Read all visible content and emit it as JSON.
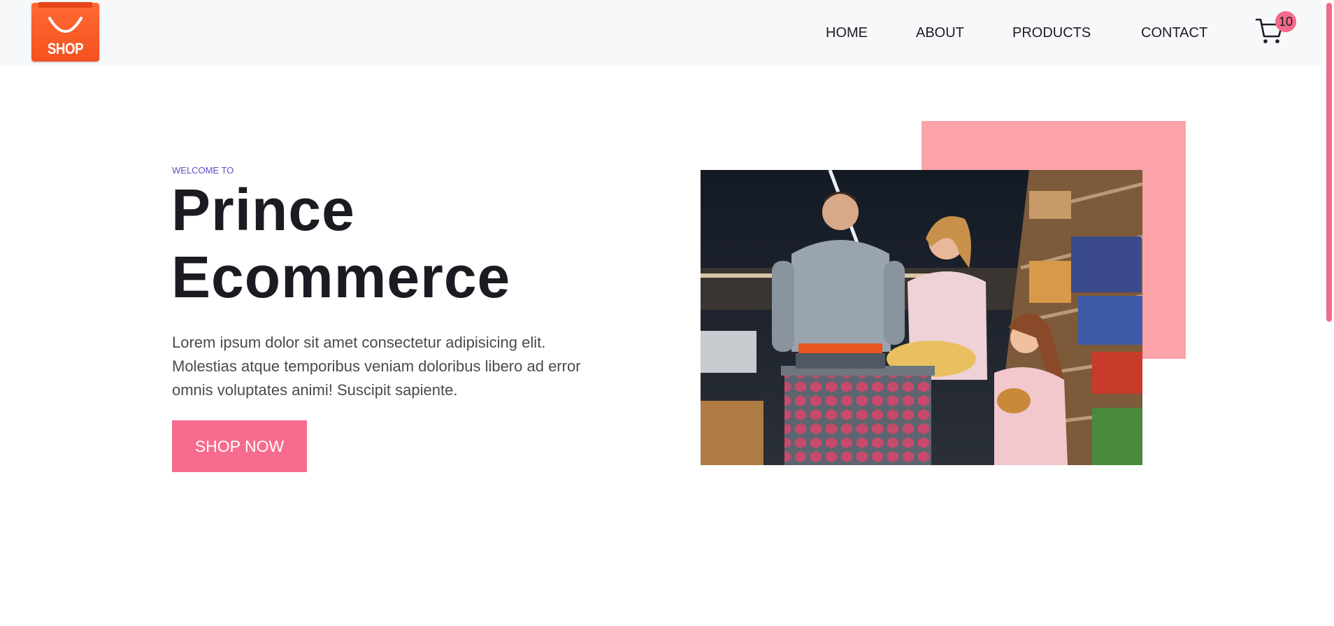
{
  "header": {
    "logo": {
      "text": "SHOP",
      "icon": "shopping-bag-icon"
    },
    "nav": [
      {
        "label": "HOME"
      },
      {
        "label": "ABOUT"
      },
      {
        "label": "PRODUCTS"
      },
      {
        "label": "CONTACT"
      }
    ],
    "cart": {
      "icon": "cart-icon",
      "count": "10"
    }
  },
  "hero": {
    "welcome": "WELCOME TO",
    "title_line1": "Prince",
    "title_line2": "Ecommerce",
    "description": "Lorem ipsum dolor sit amet consectetur adipisicing elit. Molestias atque temporibus veniam doloribus libero ad error omnis voluptates animi! Suscipit sapiente.",
    "cta_label": "SHOP NOW",
    "image": "family-shopping-in-supermarket-photo"
  },
  "colors": {
    "accent": "#f76b8e",
    "accent_box": "#fba3a8",
    "logo": "#f4511e",
    "welcome_text": "#5b4fc7",
    "header_bg": "#f7f8fa"
  }
}
